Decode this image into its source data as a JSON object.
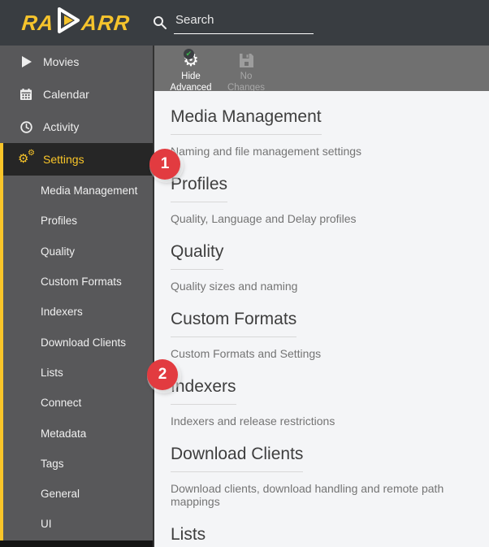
{
  "topbar": {
    "logo_left": "RA",
    "logo_right": "ARR",
    "search_placeholder": "Search"
  },
  "sidebar": {
    "items": [
      {
        "label": "Movies",
        "icon": "play-icon"
      },
      {
        "label": "Calendar",
        "icon": "calendar-icon"
      },
      {
        "label": "Activity",
        "icon": "clock-icon"
      }
    ],
    "settings": {
      "label": "Settings",
      "icon": "gears-icon"
    },
    "settings_subitems": [
      "Media Management",
      "Profiles",
      "Quality",
      "Custom Formats",
      "Indexers",
      "Download Clients",
      "Lists",
      "Connect",
      "Metadata",
      "Tags",
      "General",
      "UI"
    ]
  },
  "toolbar": {
    "hide_advanced": {
      "line1": "Hide",
      "line2": "Advanced"
    },
    "no_changes": {
      "line1": "No",
      "line2": "Changes"
    }
  },
  "main": {
    "sections": [
      {
        "title": "Media Management",
        "description": "Naming and file management settings"
      },
      {
        "title": "Profiles",
        "description": "Quality, Language and Delay profiles"
      },
      {
        "title": "Quality",
        "description": "Quality sizes and naming"
      },
      {
        "title": "Custom Formats",
        "description": "Custom Formats and Settings"
      },
      {
        "title": "Indexers",
        "description": "Indexers and release restrictions"
      },
      {
        "title": "Download Clients",
        "description": "Download clients, download handling and remote path mappings"
      },
      {
        "title": "Lists",
        "description": ""
      }
    ]
  },
  "annotations": {
    "first": "1",
    "second": "2"
  },
  "colors": {
    "accent_yellow": "#f9c529",
    "annotation_red": "#e23b40",
    "topbar_bg": "#393d41",
    "sidebar_bg": "#58585a",
    "active_item_bg": "#262626",
    "toolbar_bg": "#707070",
    "content_bg": "#f4f5f7",
    "check_green": "#39b54a"
  }
}
